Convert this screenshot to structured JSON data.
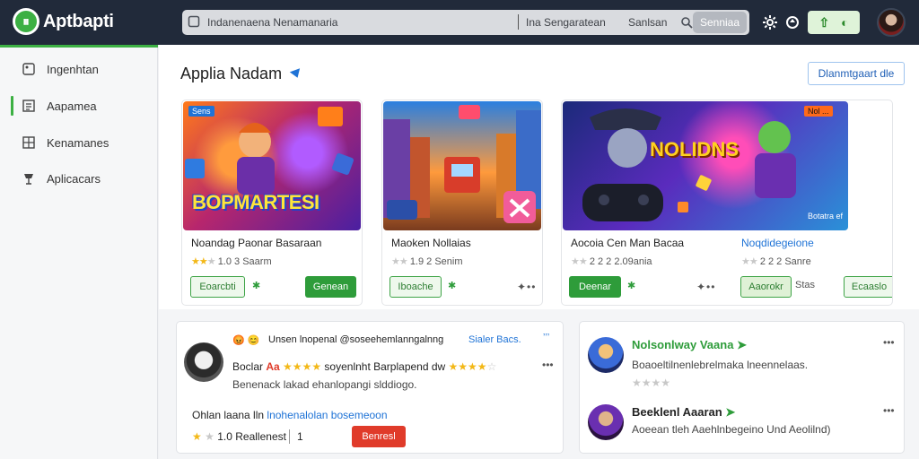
{
  "app": {
    "name": "Aptbapti"
  },
  "search": {
    "query": "Indanenaena Nenamanaria",
    "hint": "Ina Sengaratean",
    "side_label": "Sanlsan",
    "button": "Senniaa"
  },
  "sidebar": {
    "items": [
      {
        "label": "Ingenhtan",
        "icon": "image-icon"
      },
      {
        "label": "Aapamea",
        "icon": "document-icon",
        "active": true
      },
      {
        "label": "Kenamanes",
        "icon": "grid-icon"
      },
      {
        "label": "Aplicacars",
        "icon": "award-icon"
      }
    ]
  },
  "main": {
    "title": "Applia Nadam",
    "download_button": "Dlanmtgaart dle"
  },
  "cards": [
    {
      "title": "Noandag Paonar Basaraan",
      "rating": "1.0",
      "count": "3 Saarm",
      "stars_on": 2,
      "banner_tag": "Sens",
      "banner_text": "BOPMARTESI",
      "btn_outline": "Eoarcbti",
      "btn_solid": "Genean",
      "mark": "✱"
    },
    {
      "title": "Maoken Nollaias",
      "rating": "1.9",
      "count": "2 Senim",
      "stars_on": 0,
      "btn_outline": "Iboache",
      "mark": "✱",
      "dots": "✦••"
    },
    {
      "title": "Aocoia Cen Man Bacaa",
      "rating": "2 2",
      "count": "2 2.09ania",
      "stars_on": 0,
      "btn_solid": "Deenar",
      "mark": "✱",
      "dots": "✦••"
    },
    {
      "title": "Noqdidegeione",
      "rating": "2 2",
      "count": "2 Sanre",
      "stars_on": 0,
      "banner_tag": "Nol ...",
      "banner_text": "NOLIDNS",
      "banner_sub": "Botatra ef",
      "btn_outline": "Aaorokr",
      "btn_outline2": "Ecaaslo",
      "mark": "Stas"
    }
  ],
  "review_panel": {
    "header_text": "Unsen lnopenal @soseehemlanngalnng",
    "header_link": "Sialer Bacs.",
    "header_tail": "ʼʼʼ",
    "reviewer_line_a": "Boclar",
    "reviewer_line_b": "Aa",
    "reviewer_line_c": "soyenlnht Barplapend dw",
    "subtext": "Benenack lakad ehanlopangi slddiogo.",
    "link_line_prefix": "Ohlan laana lln",
    "link_line_link": "lnohenalolan bosemeoon",
    "rating": "1.0",
    "rating_label": "Reallenest",
    "rating_count": "1",
    "button": "Benresl",
    "menu": "•••"
  },
  "side_panel": {
    "items": [
      {
        "name": "Nolsonlway Vaana",
        "text": "Boaoeltilnenlebrelmaka lneennelaas.",
        "stars_on": 0,
        "menu": "•••"
      },
      {
        "name": "Beeklenl Aaaran",
        "text": "Aoeean tleh Aaehlnbegeino Und Aeolilnd)",
        "menu": "•••"
      }
    ]
  },
  "colors": {
    "topbar": "#212a3a",
    "accent": "#3cb043",
    "link": "#1f73d6",
    "danger": "#e03b2a",
    "star": "#f3b817"
  }
}
